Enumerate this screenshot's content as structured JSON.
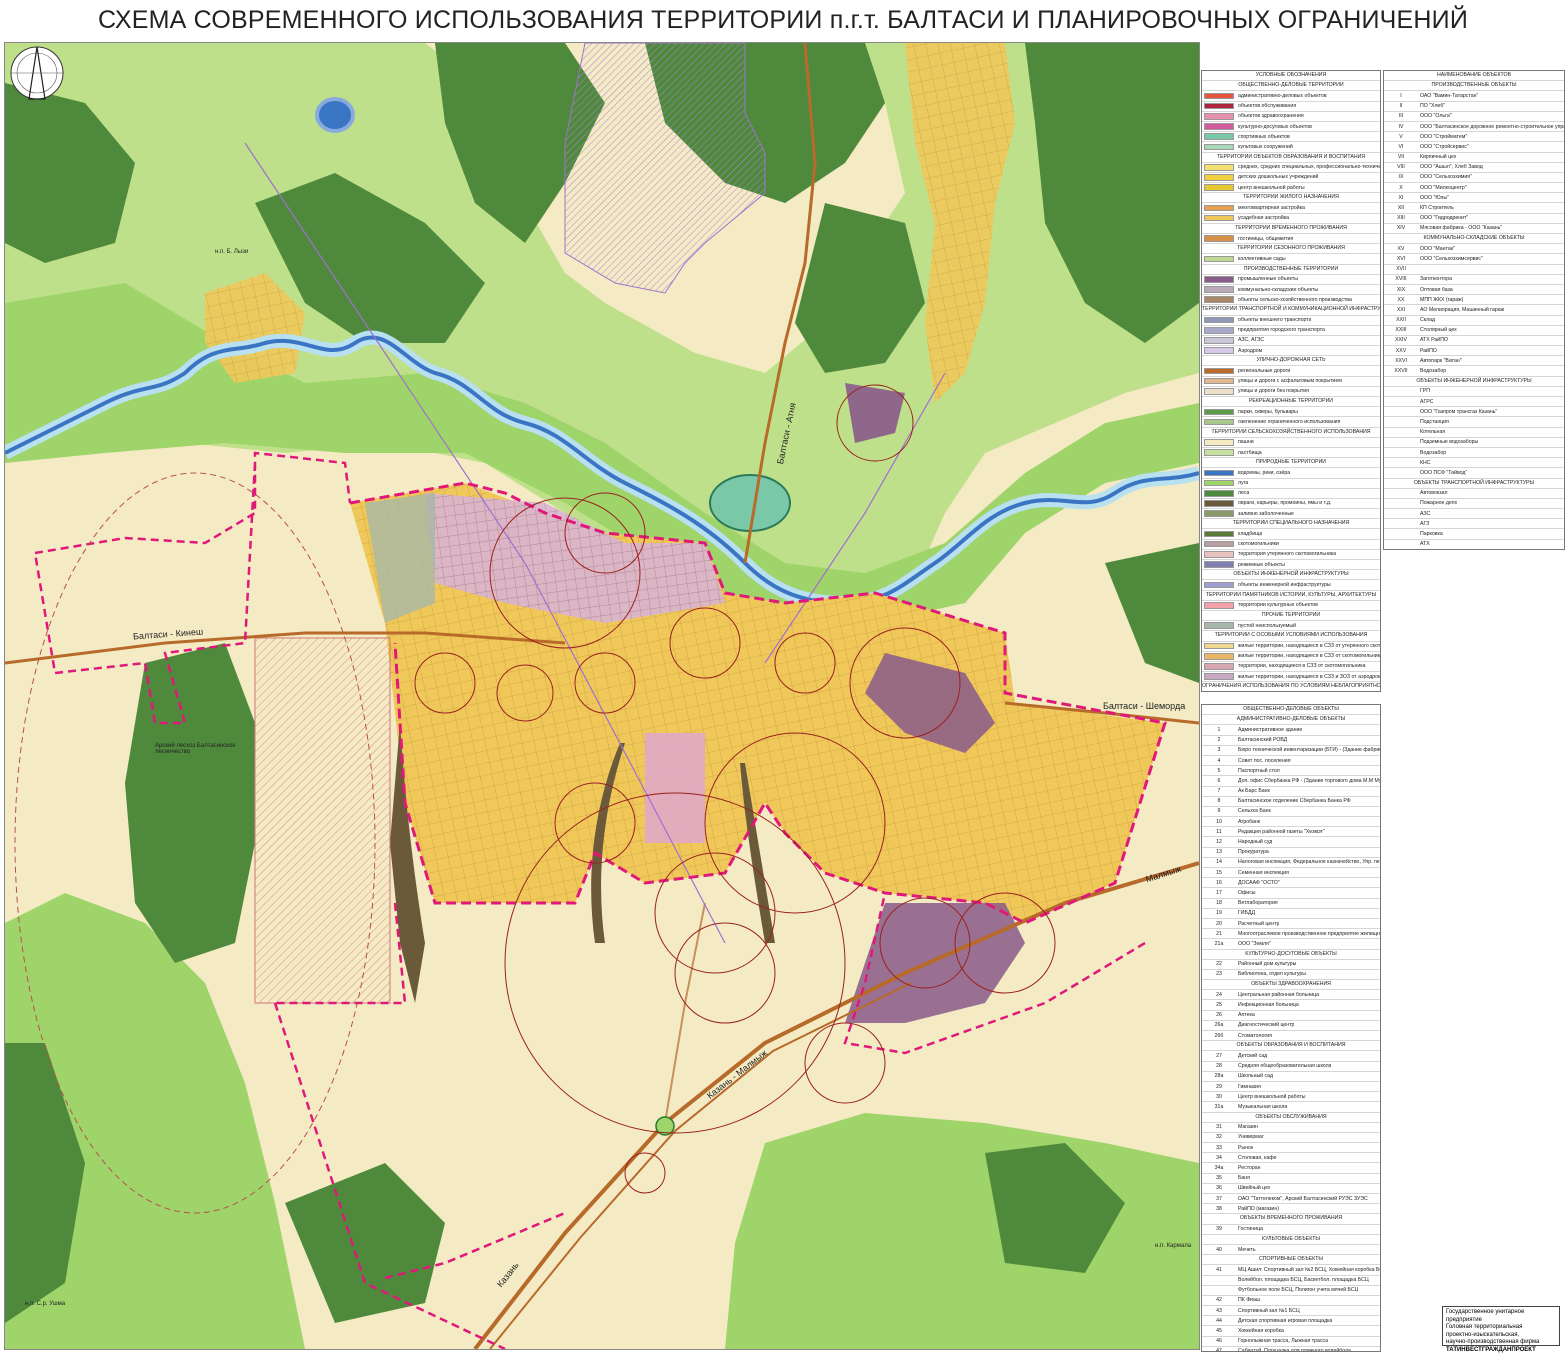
{
  "title": "СХЕМА СОВРЕМЕННОГО ИСПОЛЬЗОВАНИЯ ТЕРРИТОРИИ п.г.т. БАЛТАСИ И ПЛАНИРОВОЧНЫХ ОГРАНИЧЕНИЙ",
  "map": {
    "road_labels": [
      "Балтаси - Кинеш",
      "Балтаси - Шеморда",
      "Балтаси - Атня",
      "Казань - Малмыж",
      "Малмыж",
      "Казань"
    ],
    "place_labels": [
      "Арский лесхоз Балтасинское лесничество",
      "н.п. Б. Лызи",
      "н.п. Кармала",
      "н.п. С.р. Ушма"
    ],
    "colors": {
      "background": "#f4ebc4",
      "forest": "#4f8a3c",
      "meadow": "#9fd46a",
      "river": "#3a75c4",
      "residential": "#f0c85a",
      "industrial": "#8a5a8a",
      "boundary": "#e0187a",
      "road": "#b86a2a",
      "sanitary_circle": "#9a2020"
    }
  },
  "legend1": {
    "title": "УСЛОВНЫЕ ОБОЗНАЧЕНИЯ",
    "rows": [
      {
        "h": "ОБЩЕСТВЕННО-ДЕЛОВЫЕ ТЕРРИТОРИИ"
      },
      {
        "c": "#e8553a",
        "t": "административно-деловых объектов"
      },
      {
        "c": "#b0243c",
        "t": "объектов обслуживания"
      },
      {
        "c": "#e890b0",
        "t": "объектов здравоохранения"
      },
      {
        "c": "#d45aa0",
        "t": "культурно-досуговых объектов"
      },
      {
        "c": "#7ac8a8",
        "t": "спортивных объектов"
      },
      {
        "c": "#a8d8b8",
        "t": "культовых сооружений"
      },
      {
        "h": "ТЕРРИТОРИИ ОБЪЕКТОВ ОБРАЗОВАНИЯ И ВОСПИТАНИЯ"
      },
      {
        "c": "#f4e070",
        "t": "средних, средних специальных, профессионально-технических учебных заведений"
      },
      {
        "c": "#f0d040",
        "t": "детских дошкольных учреждений"
      },
      {
        "c": "#e8c830",
        "t": "центр внешкольной работы"
      },
      {
        "h": "ТЕРРИТОРИИ ЖИЛОГО НАЗНАЧЕНИЯ"
      },
      {
        "c": "#e8a050",
        "t": "многоквартирная застройка"
      },
      {
        "c": "#f0c85a",
        "t": "усадебная застройка"
      },
      {
        "h": "ТЕРРИТОРИИ ВРЕМЕННОГО ПРОЖИВАНИЯ"
      },
      {
        "c": "#d89048",
        "t": "гостиницы, общежития"
      },
      {
        "h": "ТЕРРИТОРИИ СЕЗОННОГО ПРОЖИВАНИЯ"
      },
      {
        "c": "#c0d890",
        "t": "коллективные сады"
      },
      {
        "h": "ПРОИЗВОДСТВЕННЫЕ ТЕРРИТОРИИ"
      },
      {
        "c": "#8a5a8a",
        "t": "промышленные объекты"
      },
      {
        "c": "#b8a8b8",
        "t": "коммунально-складские объекты"
      },
      {
        "c": "#a88868",
        "t": "объекты сельско-хозяйственного производства"
      },
      {
        "h": "ТЕРРИТОРИИ ТРАНСПОРТНОЙ И КОММУНИКАЦИОННОЙ ИНФРАСТРУКТУРЫ"
      },
      {
        "c": "#9098b8",
        "t": "объекты внешнего транспорта"
      },
      {
        "c": "#a8a8c8",
        "t": "предприятия городского транспорта"
      },
      {
        "c": "#c8c8d8",
        "t": "АЗС, АГЗС"
      },
      {
        "c": "#d8c8e8",
        "t": "Аэродром"
      },
      {
        "h": "УЛИЧНО-ДОРОЖНАЯ СЕТЬ"
      },
      {
        "c": "#b86a2a",
        "t": "региональные дороги"
      },
      {
        "c": "#e0b890",
        "t": "улицы и дороги с асфальтовым покрытием"
      },
      {
        "c": "#ece0c8",
        "t": "улицы и дороги без покрытия"
      },
      {
        "h": "РЕКРЕАЦИОННЫЕ ТЕРРИТОРИИ"
      },
      {
        "c": "#5a9a48",
        "t": "парки, скверы, бульвары"
      },
      {
        "c": "#a8c890",
        "t": "озеленение ограниченного использования"
      },
      {
        "h": "ТЕРРИТОРИИ СЕЛЬСКОХОЗЯЙСТВЕННОГО ИСПОЛЬЗОВАНИЯ"
      },
      {
        "c": "#f4ebc4",
        "t": "пашни"
      },
      {
        "c": "#c8e0a0",
        "t": "пастбища"
      },
      {
        "h": "ПРИРОДНЫЕ ТЕРРИТОРИИ"
      },
      {
        "c": "#3a75c4",
        "t": "водоемы, реки, озёра"
      },
      {
        "c": "#9fd46a",
        "t": "луга"
      },
      {
        "c": "#4f8a3c",
        "t": "леса"
      },
      {
        "c": "#6a5a3a",
        "t": "овраги, карьеры, промоины, ямы и т.д."
      },
      {
        "c": "#8a9a6a",
        "t": "заливно заболоченные"
      },
      {
        "h": "ТЕРРИТОРИИ СПЕЦИАЛЬНОГО НАЗНАЧЕНИЯ"
      },
      {
        "c": "#5a7a3a",
        "t": "кладбища"
      },
      {
        "c": "#b8a0a0",
        "t": "скотомогильники"
      },
      {
        "c": "#e8c0c0",
        "t": "территория утерянного скотомогильника"
      },
      {
        "c": "#8080b0",
        "t": "режимные объекты"
      },
      {
        "h": "ОБЪЕКТЫ ИНЖЕНЕРНОЙ ИНФРАСТРУКТУРЫ"
      },
      {
        "c": "#a0a0d0",
        "t": "объекты инженерной инфраструктуры"
      },
      {
        "h": "ТЕРРИТОРИИ ПАМЯТНИКОВ ИСТОРИИ, КУЛЬТУРЫ, АРХИТЕКТУРЫ"
      },
      {
        "c": "#f4a0a8",
        "t": "территории культурных объектов"
      },
      {
        "h": "ПРОЧИЕ ТЕРРИТОРИИ"
      },
      {
        "c": "#a8b8a8",
        "t": "пустой неиспользуемый"
      },
      {
        "h": "ТЕРРИТОРИИ С ОСОБЫМИ УСЛОВИЯМИ ИСПОЛЬЗОВАНИЯ"
      },
      {
        "c": "#f0d890",
        "t": "жилые территории, находящиеся в СЗЗ от утерянного скотомогильника"
      },
      {
        "c": "#e8b868",
        "t": "жилые территории, находящиеся в СЗЗ от скотомогильника"
      },
      {
        "c": "#d8a8b0",
        "t": "территории, находящиеся в СЗЗ от скотомогильника"
      },
      {
        "c": "#c8a8c0",
        "t": "жилые территории, находящиеся в СЗЗ и ЗОЗ от аэродрома"
      },
      {
        "h": "ОГРАНИЧЕНИЯ ИСПОЛЬЗОВАНИЯ ПО УСЛОВИЯМ НЕБЛАГОПРИЯТНОГО ВОЗДЕЙСТВИЯ НА СРЕДУ ОБИТАНИЯ И ЗДОРОВЬЕ ЧЕЛОВЕКА"
      },
      {
        "c": "#f4ebc4",
        "t": "санитарно-защитные зоны производственных, коммунально-складских и других объектов"
      },
      {
        "c": "#d8e8f4",
        "t": "водоохранная зона"
      },
      {
        "c": "#f4e0c8",
        "t": "придорожная полоса"
      },
      {
        "h": "ГРАНИЦЫ"
      },
      {
        "c": "#e0187a",
        "t": "граница населенного пункта"
      },
      {
        "c": "#f080b8",
        "t": "предлагаемая граница населенного пункта"
      },
      {
        "c": "#888888",
        "t": "граница оформленных отводов территорий под жилую застройку"
      },
      {
        "c": "#aaaaaa",
        "t": "граница оформленных отводов территорий под санитарную зону"
      }
    ]
  },
  "legend2": {
    "title": "НАИМЕНОВАНИЕ ОБЪЕКТОВ",
    "rows": [
      {
        "h": "ПРОИЗВОДСТВЕННЫЕ ОБЪЕКТЫ"
      },
      {
        "n": "I",
        "t": "ОАО \"Вамин-Татарстан\""
      },
      {
        "n": "II",
        "t": "ПО \"Хлеб\""
      },
      {
        "n": "III",
        "t": "ООО \"Ольга\""
      },
      {
        "n": "IV",
        "t": "ООО \"Балтасинское дорожное ремонтно-строительное управление 1\""
      },
      {
        "n": "V",
        "t": "ООО \"Стройматем\""
      },
      {
        "n": "VI",
        "t": "ООО \"Стройсервис\""
      },
      {
        "n": "VII",
        "t": "Кирпичный цех"
      },
      {
        "n": "VIII",
        "t": "ООО \"Ашыл\", Хлеб Завод"
      },
      {
        "n": "IX",
        "t": "ООО \"Сельхозхимия\""
      },
      {
        "n": "X",
        "t": "ООО \"Милкоцентр\""
      },
      {
        "n": "XI",
        "t": "ООО \"Юлы\""
      },
      {
        "n": "XII",
        "t": "КП Строитель"
      },
      {
        "n": "XIII",
        "t": "ООО \"Гидродренит\""
      },
      {
        "n": "XIV",
        "t": "Мясовая фабрика - ООО \"Казань\""
      },
      {
        "h": "КОММУНАЛЬНО-СКЛАДСКИЕ ОБЪЕКТЫ"
      },
      {
        "n": "XV",
        "t": "ООО \"Мантак\""
      },
      {
        "n": "XVI",
        "t": "ООО \"Сельхозхимсервис\""
      },
      {
        "n": "XVII",
        "t": ""
      },
      {
        "n": "XVIII",
        "t": "Заготконтора"
      },
      {
        "n": "XIX",
        "t": "Оптовая база"
      },
      {
        "n": "XX",
        "t": "МПП ЖКХ (гараж)"
      },
      {
        "n": "XXI",
        "t": "АО Мелиорация, Машинный гараж"
      },
      {
        "n": "XXII",
        "t": "Склад"
      },
      {
        "n": "XXIII",
        "t": "Столярный цех"
      },
      {
        "n": "XXIV",
        "t": "АТХ РайПО"
      },
      {
        "n": "XXV",
        "t": "РайПО"
      },
      {
        "n": "XXVI",
        "t": "Автопарк \"Ватан\""
      },
      {
        "n": "XXVII",
        "t": "Водозабор"
      },
      {
        "h": "ОБЪЕКТЫ ИНЖЕНЕРНОЙ ИНФРАСТРУКТУРЫ"
      },
      {
        "n": "",
        "t": "ГРП"
      },
      {
        "n": "",
        "t": "АГРС"
      },
      {
        "n": "",
        "t": "ООО \"Газпром трансгаз Казань\""
      },
      {
        "n": "",
        "t": "Подстанция"
      },
      {
        "n": "",
        "t": "Котельная"
      },
      {
        "n": "",
        "t": "Подземные водозаборы"
      },
      {
        "n": "",
        "t": "Водозабор"
      },
      {
        "n": "",
        "t": "КНС"
      },
      {
        "n": "",
        "t": "ООО ПСФ \"Тайвод\""
      },
      {
        "h": "ОБЪЕКТЫ ТРАНСПОРТНОЙ ИНФРАСТРУКТУРЫ"
      },
      {
        "n": "",
        "t": "Автовокзал"
      },
      {
        "n": "",
        "t": "Пожарное депо"
      },
      {
        "n": "",
        "t": "АЗС"
      },
      {
        "n": "",
        "t": "АГЗ"
      },
      {
        "n": "",
        "t": "Парковка"
      },
      {
        "n": "",
        "t": "АТХ"
      },
      {
        "n": "",
        "t": "СТО"
      },
      {
        "n": "",
        "t": "Аэродром"
      },
      {
        "h": "ТЕРРИТОРИИ СЕЛЬХОЗПРЕДПРИЯТИЙ"
      },
      {
        "n": "",
        "t": "ООО \"Сурнай\""
      },
      {
        "n": "",
        "t": "Ветлаборатория"
      },
      {
        "n": "",
        "t": "Инкубатор"
      },
      {
        "n": "",
        "t": "Ферма (КРС) (не ликвидна)"
      }
    ]
  },
  "legend3": {
    "rows": [
      {
        "h": "ОБЩЕСТВЕННО-ДЕЛОВЫЕ ОБЪЕКТЫ"
      },
      {
        "h": "АДМИНИСТРАТИВНО-ДЕЛОВЫЕ ОБЪЕКТЫ"
      },
      {
        "n": "1",
        "t": "Административное здание"
      },
      {
        "n": "2",
        "t": "Балтасинский РОВД"
      },
      {
        "n": "3",
        "t": "Бюро технической инвентаризации (БТИ) - (Здание фабрики М.М. Мухамед)"
      },
      {
        "n": "4",
        "t": "Совет пос. поселения"
      },
      {
        "n": "5",
        "t": "Паспортный стол"
      },
      {
        "n": "6",
        "t": "Доп. офис Сбербанка РФ - (Здание торгового дома М.М Мухамед)"
      },
      {
        "n": "7",
        "t": "Ак Барс Банк"
      },
      {
        "n": "8",
        "t": "Балтасинское отделение Сбербанка Банка РФ"
      },
      {
        "n": "9",
        "t": "Сельхоз Банк"
      },
      {
        "n": "10",
        "t": "Агробанк"
      },
      {
        "n": "11",
        "t": "Редакция районной газеты \"Хезмэт\""
      },
      {
        "n": "12",
        "t": "Народный суд"
      },
      {
        "n": "13",
        "t": "Прокуратура"
      },
      {
        "n": "14",
        "t": "Налоговая инспекция, Федеральное казначейство, Упр. пенсионный фонд"
      },
      {
        "n": "15",
        "t": "Семенная инспекция"
      },
      {
        "n": "16",
        "t": "ДОСААФ \"ОСТО\""
      },
      {
        "n": "17",
        "t": "Офисы"
      },
      {
        "n": "18",
        "t": "Ветлаборатория"
      },
      {
        "n": "19",
        "t": "ГИБДД"
      },
      {
        "n": "20",
        "t": "Расчетный центр"
      },
      {
        "n": "21",
        "t": "Многоотраслевое производственное предприятие жилищно-коммунального хозяйства МПП ЖКХ"
      },
      {
        "n": "21а",
        "t": "ООО \"Земля\""
      },
      {
        "h": "КУЛЬТУРНО-ДОСУГОВЫЕ ОБЪЕКТЫ"
      },
      {
        "n": "22",
        "t": "Районный дом культуры"
      },
      {
        "n": "23",
        "t": "Библиотека, отдел культуры"
      },
      {
        "h": "ОБЪЕКТЫ ЗДРАВООХРАНЕНИЯ"
      },
      {
        "n": "24",
        "t": "Центральная районная больница"
      },
      {
        "n": "25",
        "t": "Инфекционная больница"
      },
      {
        "n": "26",
        "t": "Аптека"
      },
      {
        "n": "26а",
        "t": "Диагностический центр"
      },
      {
        "n": "26б",
        "t": "Стоматология"
      },
      {
        "h": "ОБЪЕКТЫ ОБРАЗОВАНИЯ И ВОСПИТАНИЯ"
      },
      {
        "n": "27",
        "t": "Детский сад"
      },
      {
        "n": "28",
        "t": "Средняя общеобразовательная школа"
      },
      {
        "n": "28а",
        "t": "Школьный сад"
      },
      {
        "n": "29",
        "t": "Гимназия"
      },
      {
        "n": "30",
        "t": "Центр внешкольной работы"
      },
      {
        "n": "31а",
        "t": "Музыкальная школа"
      },
      {
        "h": "ОБЪЕКТЫ ОБСЛУЖИВАНИЯ"
      },
      {
        "n": "31",
        "t": "Магазин"
      },
      {
        "n": "32",
        "t": "Универмаг"
      },
      {
        "n": "33",
        "t": "Рынок"
      },
      {
        "n": "34",
        "t": "Столовая, кафе"
      },
      {
        "n": "34а",
        "t": "Ресторан"
      },
      {
        "n": "35",
        "t": "Баня"
      },
      {
        "n": "36",
        "t": "Швейный цех"
      },
      {
        "n": "37",
        "t": "ОАО \"Таттелеком\", Арский Балтасинский РУЭС ЗУЭС"
      },
      {
        "n": "38",
        "t": "РайПО (магазин)"
      },
      {
        "h": "ОБЪЕКТЫ ВРЕМЕННОГО ПРОЖИВАНИЯ"
      },
      {
        "n": "39",
        "t": "Гостиница"
      },
      {
        "h": "КУЛЬТОВЫЕ ОБЪЕКТЫ"
      },
      {
        "n": "40",
        "t": "Мечеть"
      },
      {
        "h": "СПОРТИВНЫЕ ОБЪЕКТЫ"
      },
      {
        "n": "41",
        "t": "МЦ Ашил: Спортивный зал №2 БСЦ, Хоккейная коробка БСЦ"
      },
      {
        "n": "",
        "t": "Волейбол. площадка БСЦ, Баскетбол. площадка БСЦ"
      },
      {
        "n": "",
        "t": "Футбольное поле БСЦ, Полигон учета мячей БСЦ"
      },
      {
        "n": "42",
        "t": "ПК Фиаш"
      },
      {
        "n": "43",
        "t": "Спортивный зал №1 БСЦ"
      },
      {
        "n": "44",
        "t": "Детская спортивная игровая площадка"
      },
      {
        "n": "45",
        "t": "Хоккейная коробка"
      },
      {
        "n": "46",
        "t": "Горнолыжная трасса, Лыжная трасса"
      },
      {
        "n": "47",
        "t": "Сабантуй, Площадка для пляжного волейбола"
      },
      {
        "h": "РЕЖИМНЫЕ ОБЪЕКТЫ"
      },
      {
        "n": "48",
        "t": "Военный комиссариат"
      }
    ]
  },
  "stamp": {
    "line1": "Государственное унитарное предприятие",
    "line2": "Головная территориальная",
    "line3": "проектно-изыскательская,",
    "line4": "научно-производственная фирма",
    "line5": "ТАТИНВЕСТГРАЖДАНПРОЕКТ"
  }
}
